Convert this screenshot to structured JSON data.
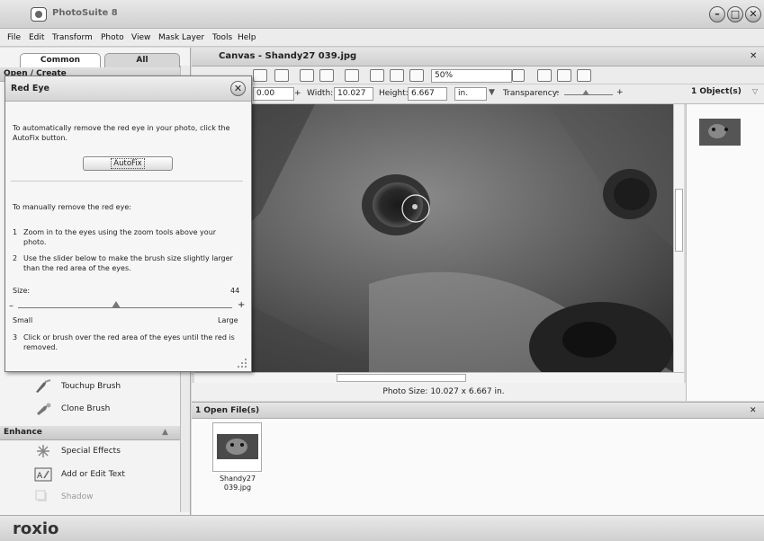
{
  "app": {
    "title": "PhotoSuite 8"
  },
  "window_buttons": [
    "–",
    "□",
    "✕"
  ],
  "menu": [
    "File",
    "Edit",
    "Transform",
    "Photo",
    "View",
    "Mask Layer",
    "Tools",
    "Help"
  ],
  "left_panel": {
    "tabs": [
      "Common",
      "All"
    ],
    "section_open_create": "Open / Create",
    "tools_visible": [
      {
        "label": "Touchup Brush",
        "icon": "touchup-brush-icon"
      },
      {
        "label": "Clone Brush",
        "icon": "clone-brush-icon"
      }
    ],
    "section_enhance": "Enhance",
    "enhance_items": [
      {
        "label": "Special Effects",
        "icon": "special-effects-icon"
      },
      {
        "label": "Add or Edit Text",
        "icon": "add-text-icon"
      },
      {
        "label": "Shadow",
        "icon": "shadow-icon"
      }
    ]
  },
  "canvas": {
    "title": "Canvas - Shandy27 039.jpg",
    "zoom": "50%",
    "x_value": "0.00",
    "width_label": "Width:",
    "width_value": "10.027",
    "height_label": "Height:",
    "height_value": "6.667",
    "unit": "in.",
    "transparency_label": "Transparency:",
    "photo_size": "Photo Size: 10.027 x 6.667 in."
  },
  "objects": {
    "count": "1 Object(s)"
  },
  "open_files": {
    "header": "1 Open File(s)",
    "files": [
      {
        "name": "Shandy27 039.jpg"
      }
    ]
  },
  "footer": {
    "brand": "roxio"
  },
  "dialog": {
    "title": "Red Eye",
    "intro": "To automatically remove the red eye in your photo, click the AutoFix button.",
    "autofix_label": "AutoFix",
    "manual_heading": "To manually remove the red eye:",
    "steps": [
      {
        "num": "1",
        "text": "Zoom in to the eyes using the zoom tools above your photo."
      },
      {
        "num": "2",
        "text": "Use the slider below to make the brush size slightly larger than the red area of the eyes."
      },
      {
        "num": "3",
        "text": "Click or brush over the red area of the eyes until the red is removed."
      }
    ],
    "size_label": "Size:",
    "size_value": "44",
    "size_fraction": 0.44,
    "min_label": "Small",
    "max_label": "Large"
  }
}
